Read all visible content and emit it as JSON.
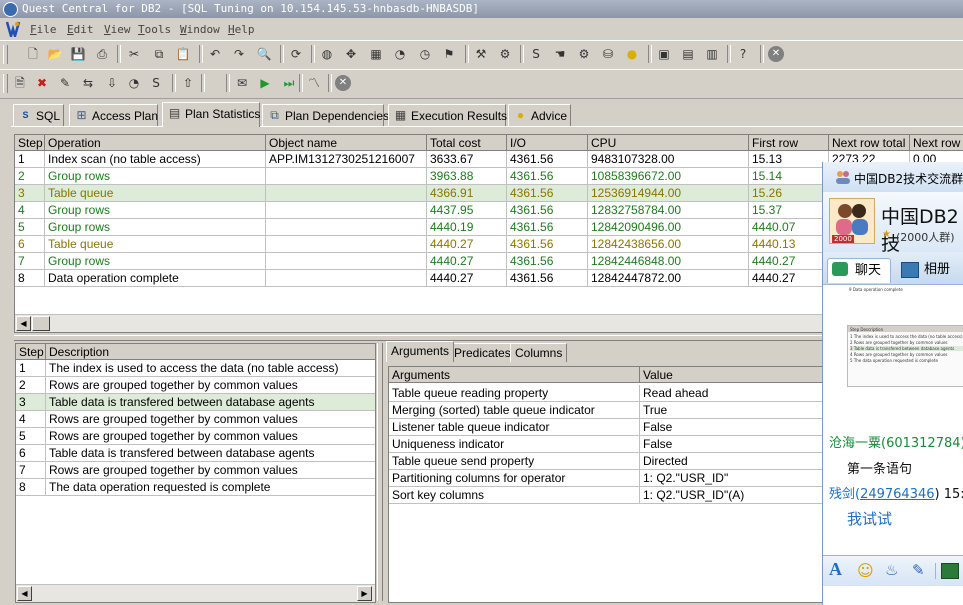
{
  "window": {
    "title": "Quest Central for DB2 - [SQL Tuning on 10.154.145.53-hnbasdb-HNBASDB]"
  },
  "menu": [
    "File",
    "Edit",
    "View",
    "Tools",
    "Window",
    "Help"
  ],
  "toolbar1_icons": [
    "new-icon",
    "open-icon",
    "save-icon",
    "print-icon",
    "cut-icon",
    "copy-icon",
    "paste-icon",
    "undo-icon",
    "redo-icon",
    "find-icon",
    "refresh-icon",
    "globe-icon",
    "compass-icon",
    "grid-icon",
    "chart-icon",
    "clock-icon",
    "flag-icon",
    "tool-icon",
    "tool2-icon",
    "sql-icon",
    "hand-icon",
    "gear-icon",
    "db-icon",
    "bulb-icon",
    "window-icon",
    "tile-h-icon",
    "tile-v-icon",
    "help-icon",
    "stop-icon"
  ],
  "toolbar2_icons": [
    "doc-icon",
    "delete-icon",
    "edit-icon",
    "link-icon",
    "import-icon",
    "chart-icon",
    "sql-icon",
    "export-icon",
    "comment-icon",
    "run-icon",
    "run-step-icon",
    "graph-icon",
    "stop-icon"
  ],
  "tabs": [
    {
      "label": "SQL",
      "icon": "sql-icon"
    },
    {
      "label": "Access Plan",
      "icon": "tree-icon"
    },
    {
      "label": "Plan Statistics",
      "icon": "stats-icon"
    },
    {
      "label": "Plan Dependencies",
      "icon": "dependencies-icon"
    },
    {
      "label": "Execution Results",
      "icon": "results-icon"
    },
    {
      "label": "Advice",
      "icon": "bulb-icon"
    }
  ],
  "active_tab": "Plan Statistics",
  "plan_table": {
    "columns": [
      "Step",
      "Operation",
      "Object name",
      "Total cost",
      "I/O",
      "CPU",
      "First row",
      "Next row total",
      "Next row I..."
    ],
    "rows": [
      {
        "step": "1",
        "operation": "Index scan (no table access)",
        "object": "APP.IM1312730251216007",
        "total_cost": "3633.67",
        "io": "4361.56",
        "cpu": "9483107328.00",
        "first_row": "15.13",
        "next_total": "2273.22",
        "next_io": "0.00",
        "color": "black"
      },
      {
        "step": "2",
        "operation": "Group rows",
        "object": "",
        "total_cost": "3963.88",
        "io": "4361.56",
        "cpu": "10858396672.00",
        "first_row": "15.14",
        "next_total": "",
        "next_io": "",
        "color": "green"
      },
      {
        "step": "3",
        "operation": "Table queue",
        "object": "",
        "total_cost": "4366.91",
        "io": "4361.56",
        "cpu": "12536914944.00",
        "first_row": "15.26",
        "next_total": "",
        "next_io": "",
        "color": "olive",
        "selected": true
      },
      {
        "step": "4",
        "operation": "Group rows",
        "object": "",
        "total_cost": "4437.95",
        "io": "4361.56",
        "cpu": "12832758784.00",
        "first_row": "15.37",
        "next_total": "",
        "next_io": "",
        "color": "green"
      },
      {
        "step": "5",
        "operation": "Group rows",
        "object": "",
        "total_cost": "4440.19",
        "io": "4361.56",
        "cpu": "12842090496.00",
        "first_row": "4440.07",
        "next_total": "",
        "next_io": "",
        "color": "green"
      },
      {
        "step": "6",
        "operation": "Table queue",
        "object": "",
        "total_cost": "4440.27",
        "io": "4361.56",
        "cpu": "12842438656.00",
        "first_row": "4440.13",
        "next_total": "",
        "next_io": "",
        "color": "olive"
      },
      {
        "step": "7",
        "operation": "Group rows",
        "object": "",
        "total_cost": "4440.27",
        "io": "4361.56",
        "cpu": "12842446848.00",
        "first_row": "4440.27",
        "next_total": "",
        "next_io": "",
        "color": "green"
      },
      {
        "step": "8",
        "operation": "Data operation complete",
        "object": "",
        "total_cost": "4440.27",
        "io": "4361.56",
        "cpu": "12842447872.00",
        "first_row": "4440.27",
        "next_total": "",
        "next_io": "",
        "color": "black"
      }
    ]
  },
  "desc_table": {
    "columns": [
      "Step",
      "Description"
    ],
    "rows": [
      {
        "step": "1",
        "description": "The index is used to access the data (no table access)"
      },
      {
        "step": "2",
        "description": "Rows are grouped together by common values"
      },
      {
        "step": "3",
        "description": "Table data is transfered between database agents",
        "selected": true
      },
      {
        "step": "4",
        "description": "Rows are grouped together by common values"
      },
      {
        "step": "5",
        "description": "Rows are grouped together by common values"
      },
      {
        "step": "6",
        "description": "Table data is transfered between database agents"
      },
      {
        "step": "7",
        "description": "Rows are grouped together by common values"
      },
      {
        "step": "8",
        "description": "The data operation requested is complete"
      }
    ]
  },
  "sub_tabs": [
    "Arguments",
    "Predicates",
    "Columns"
  ],
  "args_table": {
    "columns": [
      "Arguments",
      "Value"
    ],
    "rows": [
      {
        "arg": "Table queue reading property",
        "value": "Read ahead"
      },
      {
        "arg": "Merging (sorted) table queue indicator",
        "value": "True"
      },
      {
        "arg": "Listener table queue indicator",
        "value": "False"
      },
      {
        "arg": "Uniqueness indicator",
        "value": "False"
      },
      {
        "arg": "Table queue send property",
        "value": "Directed"
      },
      {
        "arg": "Partitioning columns for operator",
        "value": "1: Q2.\"USR_ID\""
      },
      {
        "arg": "Sort key columns",
        "value": "1: Q2.\"USR_ID\"(A)"
      }
    ]
  },
  "qq": {
    "window_title": "中国DB2技术交流群",
    "group_name": "中国DB2技",
    "member_info": "(2000人群)",
    "avatar_badge": "2000",
    "tab_chat": "聊天",
    "tab_album": "相册",
    "thumb_rows": [
      "9 Data operation complete",
      "Step Description",
      "1 The index is used to access the data (no table access)",
      "2 Rows are grouped together by common values",
      "3 Table data is transfered between database agents",
      "4 Rows are grouped together by common values",
      "5 The data operation requested is complete"
    ],
    "msg1_sender": "沧海一粟(601312784)",
    "msg1_text": "第一条语句",
    "msg2_sender_name": "残剑(",
    "msg2_sender_id": "249764346",
    "msg2_sender_tail": ")  15:",
    "msg2_text": "我试试"
  },
  "colors": {
    "green_row": "#1e7a1e",
    "olive_row": "#8a7400",
    "selected_bg": "#dcecd8",
    "qq_blue": "#1f6fc4",
    "qq_green": "#1a8a3a"
  }
}
